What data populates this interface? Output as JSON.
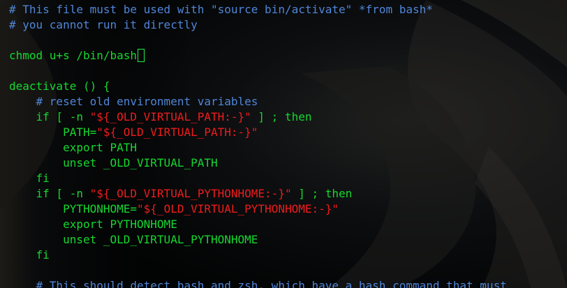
{
  "editor": {
    "lines": [
      [
        {
          "text": "# This file must be used with \"source bin/activate\" *from bash*",
          "class": "comment"
        }
      ],
      [
        {
          "text": "# you cannot run it directly",
          "class": "comment"
        }
      ],
      [],
      [
        {
          "text": "chmod u+s /bin/bash",
          "class": "green"
        }
      ],
      [],
      [
        {
          "text": "deactivate () {",
          "class": "green"
        }
      ],
      [
        {
          "text": "    # reset old environment variables",
          "class": "comment"
        }
      ],
      [
        {
          "text": "    if [ -n ",
          "class": "green"
        },
        {
          "text": "\"${_OLD_VIRTUAL_PATH:-}\"",
          "class": "string"
        },
        {
          "text": " ] ; then",
          "class": "green"
        }
      ],
      [
        {
          "text": "        PATH=",
          "class": "green"
        },
        {
          "text": "\"${_OLD_VIRTUAL_PATH:-}\"",
          "class": "string"
        }
      ],
      [
        {
          "text": "        export PATH",
          "class": "green"
        }
      ],
      [
        {
          "text": "        unset _OLD_VIRTUAL_PATH",
          "class": "green"
        }
      ],
      [
        {
          "text": "    fi",
          "class": "green"
        }
      ],
      [
        {
          "text": "    if [ -n ",
          "class": "green"
        },
        {
          "text": "\"${_OLD_VIRTUAL_PYTHONHOME:-}\"",
          "class": "string"
        },
        {
          "text": " ] ; then",
          "class": "green"
        }
      ],
      [
        {
          "text": "        PYTHONHOME=",
          "class": "green"
        },
        {
          "text": "\"${_OLD_VIRTUAL_PYTHONHOME:-}\"",
          "class": "string"
        }
      ],
      [
        {
          "text": "        export PYTHONHOME",
          "class": "green"
        }
      ],
      [
        {
          "text": "        unset _OLD_VIRTUAL_PYTHONHOME",
          "class": "green"
        }
      ],
      [
        {
          "text": "    fi",
          "class": "green"
        }
      ],
      [],
      [
        {
          "text": "    # This should detect bash and zsh, which have a hash command that must",
          "class": "comment"
        }
      ]
    ],
    "cursor": {
      "line_index": 3
    }
  }
}
